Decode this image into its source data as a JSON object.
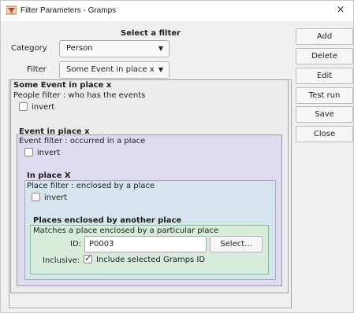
{
  "window": {
    "title": "Filter Parameters - Gramps",
    "close_glyph": "×"
  },
  "selector": {
    "heading": "Select a filter",
    "category_label": "Category",
    "category_value": "Person",
    "filter_label": "Filter",
    "filter_value": "Some Event in place x"
  },
  "buttons": {
    "add": "Add",
    "delete": "Delete",
    "edit": "Edit",
    "test_run": "Test run",
    "save": "Save",
    "close": "Close"
  },
  "panels": {
    "root": {
      "title": "Some Event in place x",
      "desc": "People filter : who has the events",
      "invert_label": "invert",
      "invert": false
    },
    "event": {
      "title": "Event in place x",
      "desc": "Event filter : occurred in a place",
      "invert_label": "invert",
      "invert": false
    },
    "place": {
      "title": "In place X",
      "desc": "Place filter : enclosed by a place",
      "invert_label": "invert",
      "invert": false
    },
    "enclosed": {
      "title": "Places enclosed by another place",
      "desc": "Matches a place enclosed by a particular place",
      "id_label": "ID:",
      "id_value": "P0003",
      "select_label": "Select...",
      "inclusive_label": "Inclusive:",
      "inclusive_text": "Include selected Gramps ID",
      "inclusive": true
    }
  },
  "icons": {
    "app": "gramps-filter-icon",
    "dropdown": "chevron-down-icon",
    "close": "close-icon"
  }
}
